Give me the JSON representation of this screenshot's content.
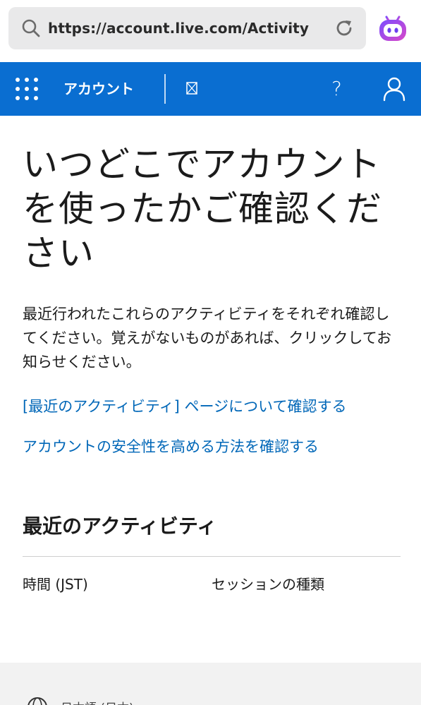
{
  "browser": {
    "url": "https://account.live.com/Activity"
  },
  "header": {
    "brand": "アカウント",
    "help": "?"
  },
  "main": {
    "title": "いつどこでアカウントを使ったかご確認ください",
    "intro": "最近行われたこれらのアクティビティをそれぞれ確認してください。覚えがないものがあれば、クリックしてお知らせください。",
    "links": [
      "[最近のアクティビティ] ページについて確認する",
      "アカウントの安全性を高める方法を確認する"
    ],
    "section_title": "最近のアクティビティ",
    "columns": [
      "時間 (JST)",
      "セッションの種類"
    ]
  },
  "footer": {
    "language": "日本語 (日本)"
  },
  "colors": {
    "header_bg": "#0a6ed1",
    "link": "#0067b8",
    "url_bar": "#e9e9ea",
    "footer_bg": "#f2f2f2"
  }
}
